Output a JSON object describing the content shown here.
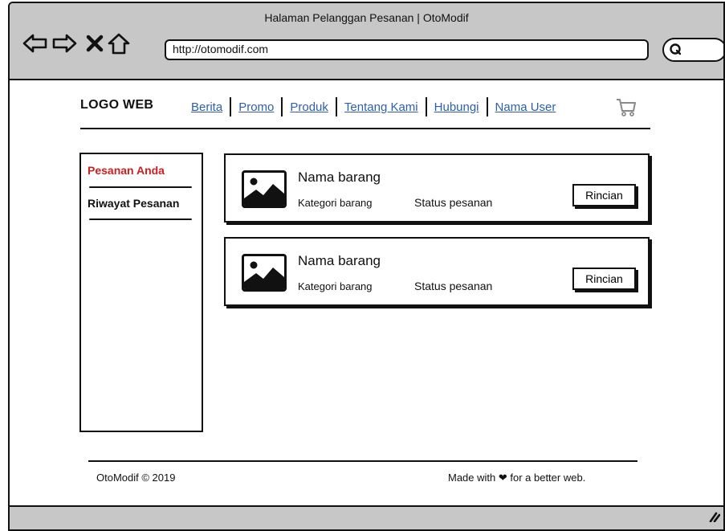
{
  "window": {
    "title": "Halaman Pelanggan Pesanan | OtoModif"
  },
  "browser": {
    "url": "http://otomodif.com",
    "icons": [
      "back-arrow-icon",
      "forward-arrow-icon",
      "close-x-icon",
      "home-icon",
      "search-icon",
      "resize-grip-icon"
    ]
  },
  "header": {
    "logo": "LOGO WEB",
    "nav": [
      "Berita",
      "Promo",
      "Produk",
      "Tentang Kami",
      "Hubungi",
      "Nama User"
    ],
    "cart_icon": "shopping-cart-icon"
  },
  "sidebar": {
    "items": [
      {
        "label": "Pesanan Anda",
        "active": true
      },
      {
        "label": "Riwayat Pesanan",
        "active": false
      }
    ]
  },
  "orders": [
    {
      "name": "Nama barang",
      "category": "Kategori barang",
      "status": "Status pesanan",
      "button": "Rincian",
      "icon": "image-placeholder-icon"
    },
    {
      "name": "Nama barang",
      "category": "Kategori barang",
      "status": "Status pesanan",
      "button": "Rincian",
      "icon": "image-placeholder-icon"
    }
  ],
  "footer": {
    "copyright": "OtoModif © 2019",
    "made_with": "Made with ❤ for a better web."
  },
  "colors": {
    "chrome_gray": "#c7c7c7",
    "link_blue": "#2e5fa8",
    "active_red": "#cc1f1f",
    "ink": "#111111"
  }
}
